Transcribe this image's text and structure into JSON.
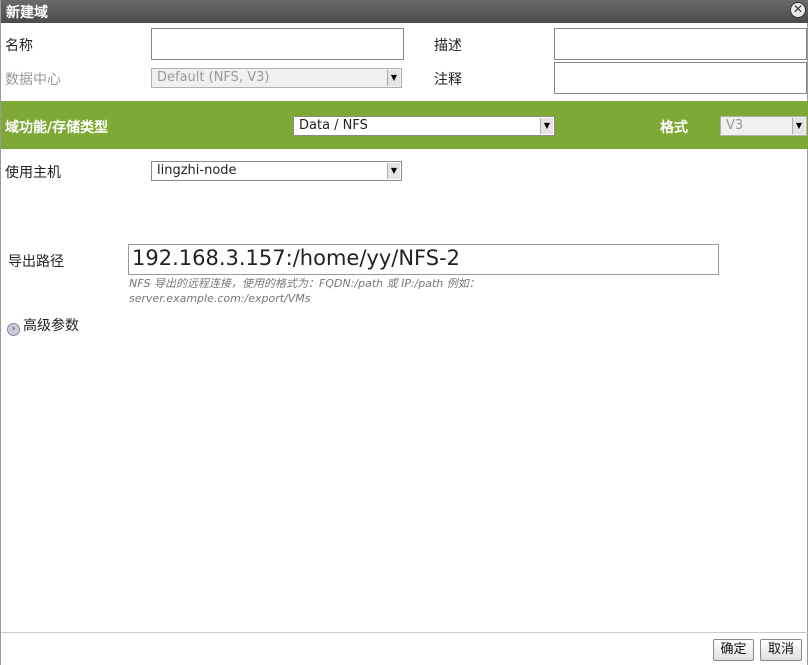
{
  "dialog": {
    "title": "新建域",
    "close_symbol": "✕"
  },
  "form": {
    "name_label": "名称",
    "name_value": "",
    "description_label": "描述",
    "description_value": "",
    "datacenter_label": "数据中心",
    "datacenter_value": "Default (NFS, V3)",
    "comment_label": "注释",
    "comment_value": ""
  },
  "domain_type": {
    "label": "域功能/存储类型",
    "value": "Data / NFS",
    "format_label": "格式",
    "format_value": "V3"
  },
  "host": {
    "label": "使用主机",
    "value": "lingzhi-node"
  },
  "export": {
    "label": "导出路径",
    "value": "192.168.3.157:/home/yy/NFS-2",
    "hint_line1": "NFS 导出的远程连接，使用的格式为：FQDN:/path 或 IP:/path 例如：",
    "hint_line2": "server.example.com:/export/VMs"
  },
  "advanced": {
    "label": "高级参数"
  },
  "buttons": {
    "ok": "确定",
    "cancel": "取消"
  },
  "colors": {
    "title_bar": "#555555",
    "band": "#7ea934"
  },
  "icons": {
    "close": "close-icon",
    "dropdown": "chevron-down-icon",
    "expand": "chevron-right-icon"
  }
}
